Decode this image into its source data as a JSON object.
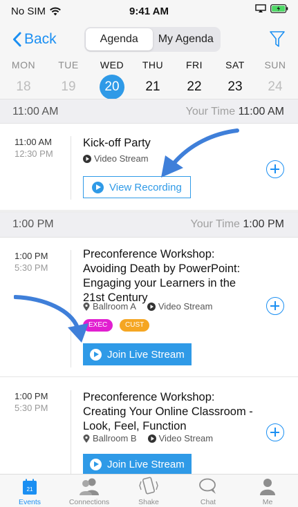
{
  "status_bar": {
    "carrier": "No SIM",
    "time": "9:41 AM"
  },
  "nav": {
    "back_label": "Back",
    "segments": [
      "Agenda",
      "My Agenda"
    ],
    "active_segment": "Agenda"
  },
  "days": [
    {
      "name": "MON",
      "date": "18"
    },
    {
      "name": "TUE",
      "date": "19"
    },
    {
      "name": "WED",
      "date": "20"
    },
    {
      "name": "THU",
      "date": "21"
    },
    {
      "name": "FRI",
      "date": "22"
    },
    {
      "name": "SAT",
      "date": "23"
    },
    {
      "name": "SUN",
      "date": "24"
    }
  ],
  "selected_day": "20",
  "slots": [
    {
      "time": "11:00 AM",
      "your_time_label": "Your Time",
      "your_time": "11:00 AM"
    },
    {
      "time": "1:00 PM",
      "your_time_label": "Your Time",
      "your_time": "1:00 PM"
    }
  ],
  "sessions": [
    {
      "start": "11:00 AM",
      "end": "12:30 PM",
      "title": "Kick-off Party",
      "location": "",
      "stream": "Video Stream",
      "button": "View Recording"
    },
    {
      "start": "1:00 PM",
      "end": "5:30 PM",
      "title_lines": [
        "Preconference Workshop:",
        "Avoiding Death by PowerPoint:",
        "Engaging your Learners in the",
        "21st Century"
      ],
      "location": "Ballroom A",
      "stream": "Video Stream",
      "tags": [
        {
          "label": "EXEC",
          "color": "#e11fd0"
        },
        {
          "label": "CUST",
          "color": "#f5a623"
        }
      ],
      "button": "Join Live Stream"
    },
    {
      "start": "1:00 PM",
      "end": "5:30 PM",
      "title_lines": [
        "Preconference Workshop:",
        "Creating Your Online Classroom -",
        "Look, Feel, Function"
      ],
      "location": "Ballroom B",
      "stream": "Video Stream",
      "button": "Join Live Stream"
    }
  ],
  "tabbar": {
    "calendar_day": "21",
    "items": [
      "Events",
      "Connections",
      "Shake",
      "Chat",
      "Me"
    ],
    "active": "Events"
  },
  "colors": {
    "accent": "#1b8ff2",
    "button": "#2f9ae7",
    "annotation_arrow": "#3f7fd9"
  }
}
